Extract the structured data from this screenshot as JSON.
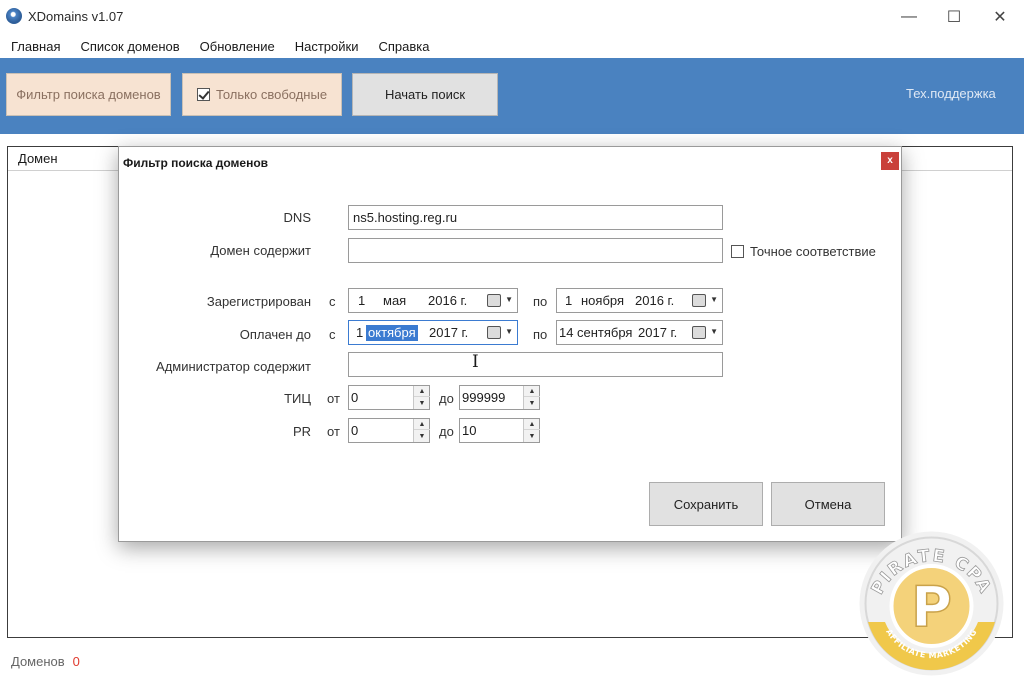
{
  "window": {
    "title": "XDomains v1.07",
    "controls": {
      "minimize": "—",
      "maximize": "☐",
      "close": "✕"
    }
  },
  "menu": [
    "Главная",
    "Список доменов",
    "Обновление",
    "Настройки",
    "Справка"
  ],
  "toolbar": {
    "filter_button": "Фильтр поиска доменов",
    "free_only_label": "Только свободные",
    "free_only_checked": true,
    "search_button": "Начать поиск",
    "support_link": "Тех.поддержка"
  },
  "main": {
    "column_header": "Домен",
    "status_label": "Доменов",
    "status_count": "0"
  },
  "dialog": {
    "title": "Фильтр поиска доменов",
    "close": "x",
    "fields": {
      "dns_label": "DNS",
      "dns_value": "ns5.hosting.reg.ru",
      "domain_contains_label": "Домен содержит",
      "domain_contains_value": "",
      "exact_match_label": "Точное соответствие",
      "exact_match_checked": false,
      "registered_label": "Зарегистрирован",
      "from_word": "с",
      "to_word": "по",
      "registered_from": {
        "day": "1",
        "month": "мая",
        "year": "2016 г."
      },
      "registered_to": {
        "day": "1",
        "month": "ноября",
        "year": "2016 г."
      },
      "paid_until_label": "Оплачен до",
      "paid_from": {
        "day": "1",
        "month": "октября",
        "year": "2017 г."
      },
      "paid_to": {
        "day": "14",
        "month": "сентября",
        "year": "2017 г."
      },
      "admin_contains_label": "Администратор содержит",
      "admin_contains_value": "",
      "tic_label": "ТИЦ",
      "pr_label": "PR",
      "range_from": "от",
      "range_to": "до",
      "tic_from": "0",
      "tic_to": "999999",
      "pr_from": "0",
      "pr_to": "10"
    },
    "buttons": {
      "save": "Сохранить",
      "cancel": "Отмена"
    }
  },
  "watermark": {
    "top_text": "PIRATE CPA",
    "bottom_text": "AFFILIATE MARKETING",
    "letter": "P"
  },
  "colors": {
    "toolbar_bg": "#4a82c0",
    "accent_selection": "#3b7bd1",
    "close_red": "#c9403a",
    "status_count": "#e03a2e"
  }
}
